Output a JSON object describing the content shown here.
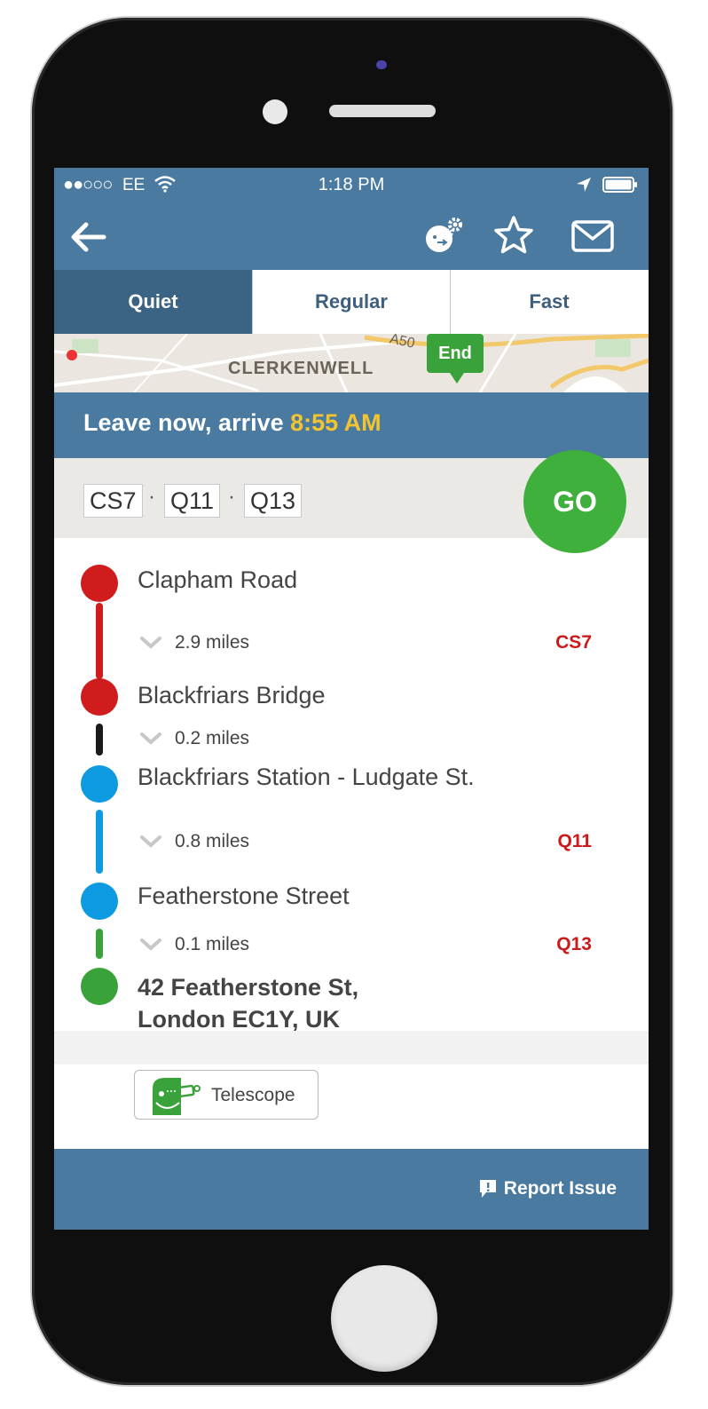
{
  "status_bar": {
    "signal": "●●○○○",
    "carrier": "EE",
    "time": "1:18 PM"
  },
  "header": {
    "icons": [
      "back-arrow-icon",
      "route-preferences-icon",
      "star-icon",
      "mail-icon"
    ]
  },
  "tabs": [
    {
      "label": "Quiet",
      "active": true
    },
    {
      "label": "Regular",
      "active": false
    },
    {
      "label": "Fast",
      "active": false
    }
  ],
  "map": {
    "area_label": "CLERKENWELL",
    "road_label": "A50",
    "end_marker": "End"
  },
  "leave": {
    "prefix": "Leave now, arrive ",
    "arrival_time": "8:55 AM"
  },
  "routes": [
    "CS7",
    "Q11",
    "Q13"
  ],
  "route_separator": "·",
  "go_label": "GO",
  "stops": [
    {
      "name": "Clapham Road",
      "color": "#d01c1c"
    },
    {
      "name": "Blackfriars Bridge",
      "color": "#d01c1c"
    },
    {
      "name": "Blackfriars Station - Ludgate St.",
      "color": "#0d9ae0"
    },
    {
      "name": "Featherstone Street",
      "color": "#0d9ae0"
    }
  ],
  "legs": [
    {
      "distance": "2.9 miles",
      "route": "CS7",
      "color": "#d01c1c"
    },
    {
      "distance": "0.2 miles",
      "route": "",
      "color": "#1a1a1a"
    },
    {
      "distance": "0.8 miles",
      "route": "Q11",
      "color": "#0d9ae0"
    },
    {
      "distance": "0.1 miles",
      "route": "Q13",
      "color": "#3aa23a"
    }
  ],
  "destination": {
    "line1": "42 Featherstone St,",
    "line2": "London EC1Y, UK",
    "color": "#3aa23a"
  },
  "telescope": {
    "label": "Telescope"
  },
  "footer": {
    "report_label": "Report Issue"
  },
  "colors": {
    "brand_blue": "#4a7aa0",
    "active_tab": "#3b6383",
    "go_green": "#3fb03b",
    "arrival_yellow": "#f4c430",
    "route_red": "#cc1a1a"
  }
}
